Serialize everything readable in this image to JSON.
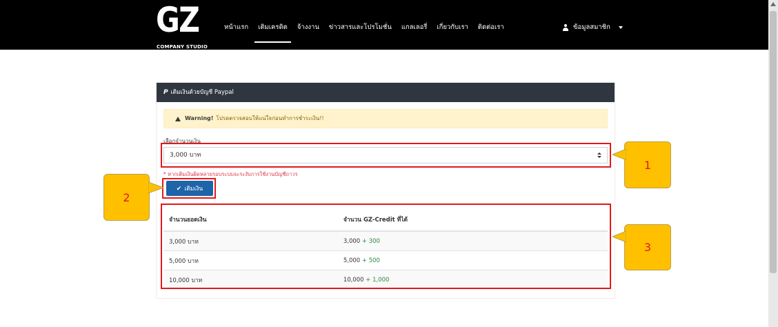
{
  "nav": {
    "logo_main": "GZ",
    "logo_sub": "COMPANY STUDIO",
    "items": [
      {
        "label": "หน้าแรก",
        "active": false
      },
      {
        "label": "เติมเครดิต",
        "active": true
      },
      {
        "label": "จ้างงาน",
        "active": false
      },
      {
        "label": "ข่าวสารและโปรโมชั่น",
        "active": false
      },
      {
        "label": "แกลเลอรี่",
        "active": false
      },
      {
        "label": "เกี่ยวกับเรา",
        "active": false
      },
      {
        "label": "ติดต่อเรา",
        "active": false
      }
    ],
    "user_label": "ข้อมูลสมาชิก"
  },
  "panel": {
    "header_icon": "paypal-icon",
    "title": "เติมเงินด้วยบัญชี Paypal",
    "warning_strong": "Warning!",
    "warning_text": "โปรดตรวจสอบให้แน่ใจก่อนทำการชำระเงิน!!",
    "select_label": "เลือกจำนวนเงิน",
    "select_value": "3,000 บาท",
    "note": "* หากเติมเงินผิดหลายรอบระบบจะระงับการใช้งานบัญชีถาวร",
    "submit_label": "เติมเงิน"
  },
  "table": {
    "headers": [
      "จำนวนยอดเงิน",
      "จำนวน GZ-Credit ที่ได้"
    ],
    "rows": [
      {
        "amount": "3,000 บาท",
        "credit": "3,000",
        "bonus": "+ 300"
      },
      {
        "amount": "5,000 บาท",
        "credit": "5,000",
        "bonus": "+ 500"
      },
      {
        "amount": "10,000 บาท",
        "credit": "10,000",
        "bonus": "+ 1,000"
      }
    ]
  },
  "callouts": [
    "1",
    "2",
    "3"
  ],
  "colors": {
    "navbar": "#000000",
    "panel_header": "#2f3640",
    "button": "#1d64a9",
    "highlight": "#e31818",
    "callout": "#ffc000",
    "bonus": "#2b8a3e"
  }
}
